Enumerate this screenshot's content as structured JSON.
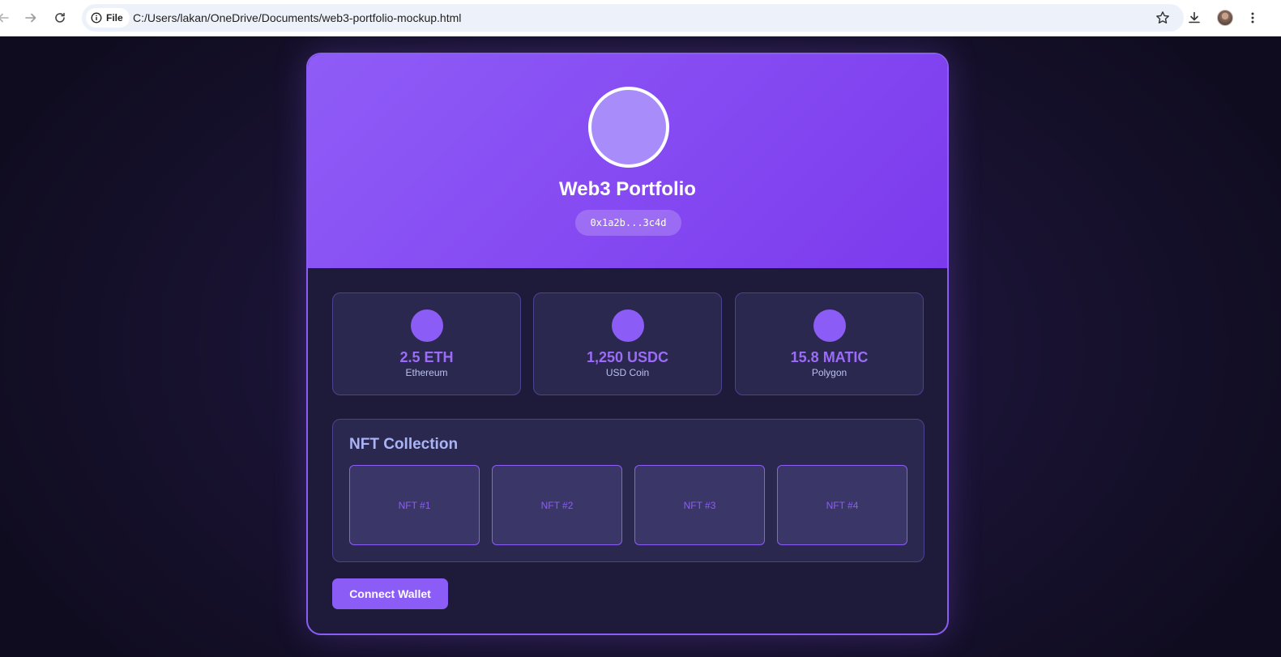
{
  "browser": {
    "site_chip_label": "File",
    "url": "C:/Users/lakan/OneDrive/Documents/web3-portfolio-mockup.html",
    "icons": [
      "back-arrow-icon",
      "forward-arrow-icon",
      "reload-icon",
      "info-icon",
      "star-icon",
      "download-icon",
      "more-vert-icon"
    ]
  },
  "profile": {
    "title": "Web3 Portfolio",
    "address": "0x1a2b...3c4d"
  },
  "balances": [
    {
      "amount": "2.5 ETH",
      "name": "Ethereum"
    },
    {
      "amount": "1,250 USDC",
      "name": "USD Coin"
    },
    {
      "amount": "15.8 MATIC",
      "name": "Polygon"
    }
  ],
  "nft": {
    "title": "NFT Collection",
    "items": [
      "NFT #1",
      "NFT #2",
      "NFT #3",
      "NFT #4"
    ]
  },
  "actions": {
    "connect_label": "Connect Wallet"
  },
  "colors": {
    "accent": "#8b5cf6",
    "header_gradient_start": "#8f5cf7",
    "header_gradient_end": "#7c3aed",
    "card_bg": "#1e1b3a",
    "panel_bg": "#2b2850",
    "muted_text": "#b8c0f0"
  }
}
